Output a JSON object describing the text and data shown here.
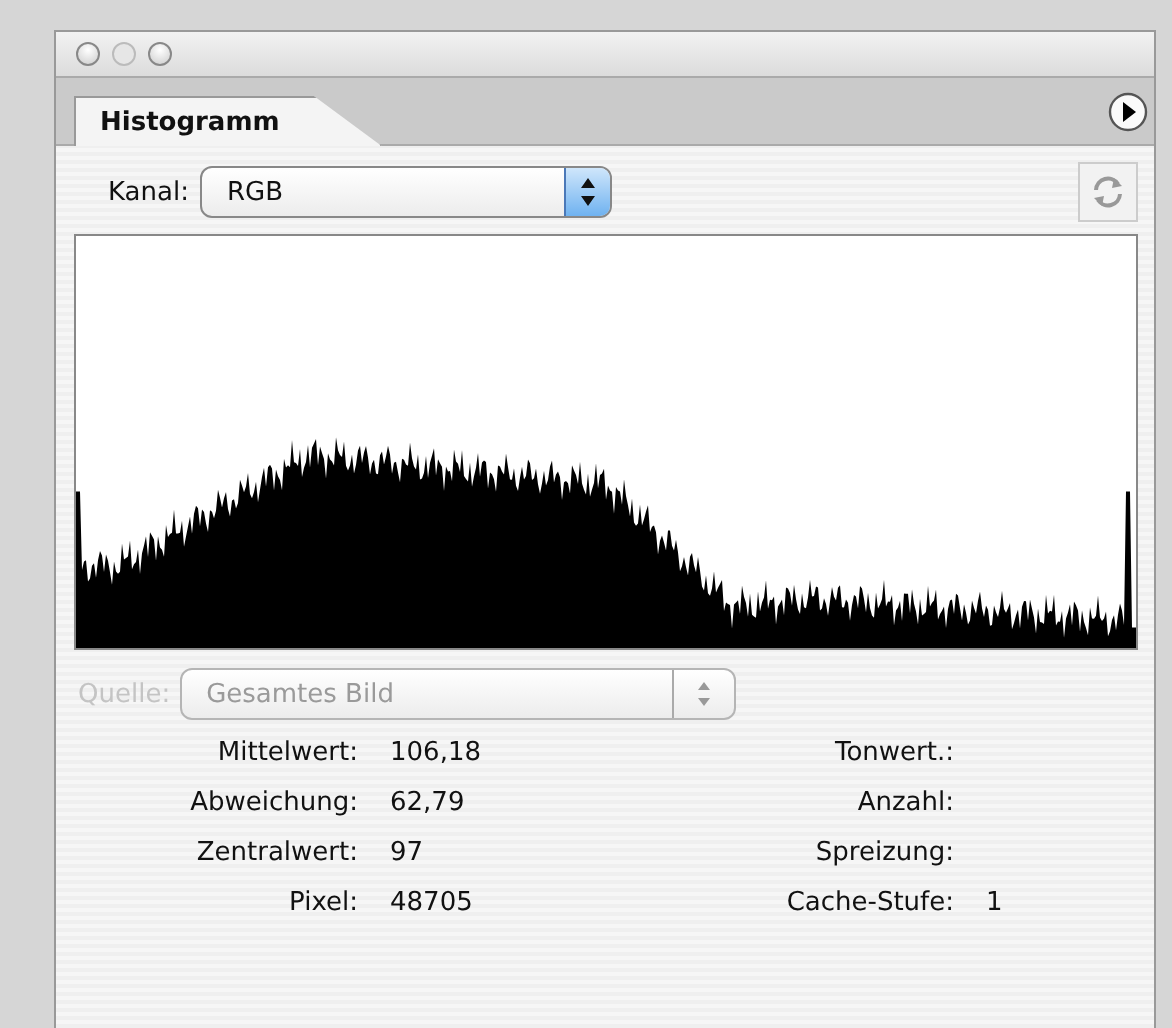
{
  "panel": {
    "tab": "Histogramm"
  },
  "channel": {
    "label": "Kanal:",
    "value": "RGB"
  },
  "source": {
    "label": "Quelle:",
    "value": "Gesamtes Bild",
    "disabled": true
  },
  "stats_left": [
    {
      "label": "Mittelwert:",
      "value": "106,18"
    },
    {
      "label": "Abweichung:",
      "value": "62,79"
    },
    {
      "label": "Zentralwert:",
      "value": "97"
    },
    {
      "label": "Pixel:",
      "value": "48705"
    }
  ],
  "stats_right": [
    {
      "label": "Tonwert.:"
    },
    {
      "label": "Anzahl:"
    },
    {
      "label": "Spreizung:"
    },
    {
      "label": "Cache-Stufe:",
      "value": "1"
    }
  ]
}
